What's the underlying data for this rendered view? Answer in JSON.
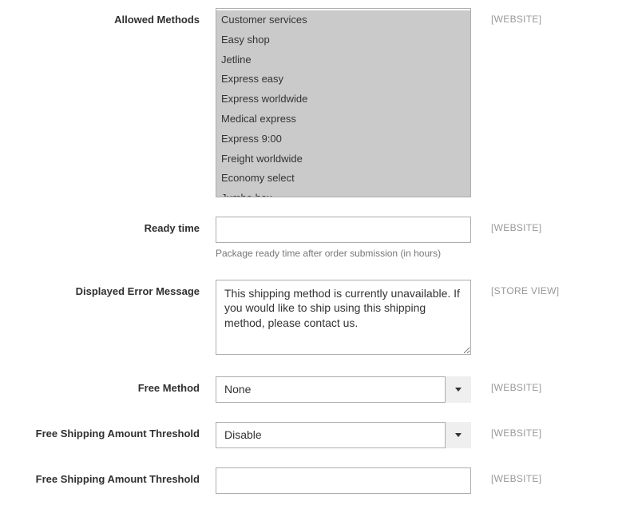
{
  "scopes": {
    "website": "[WEBSITE]",
    "store_view": "[STORE VIEW]"
  },
  "fields": {
    "allowed_methods": {
      "label": "Allowed Methods",
      "options": [
        "Customer services",
        "Easy shop",
        "Jetline",
        "Express easy",
        "Express worldwide",
        "Medical express",
        "Express 9:00",
        "Freight worldwide",
        "Economy select",
        "Jumbo box"
      ]
    },
    "ready_time": {
      "label": "Ready time",
      "value": "",
      "hint": "Package ready time after order submission (in hours)"
    },
    "displayed_error_message": {
      "label": "Displayed Error Message",
      "value": "This shipping method is currently unavailable. If you would like to ship using this shipping method, please contact us."
    },
    "free_method": {
      "label": "Free Method",
      "value": "None"
    },
    "free_shipping_threshold_toggle": {
      "label": "Free Shipping Amount Threshold",
      "value": "Disable"
    },
    "free_shipping_threshold_value": {
      "label": "Free Shipping Amount Threshold",
      "value": ""
    }
  }
}
